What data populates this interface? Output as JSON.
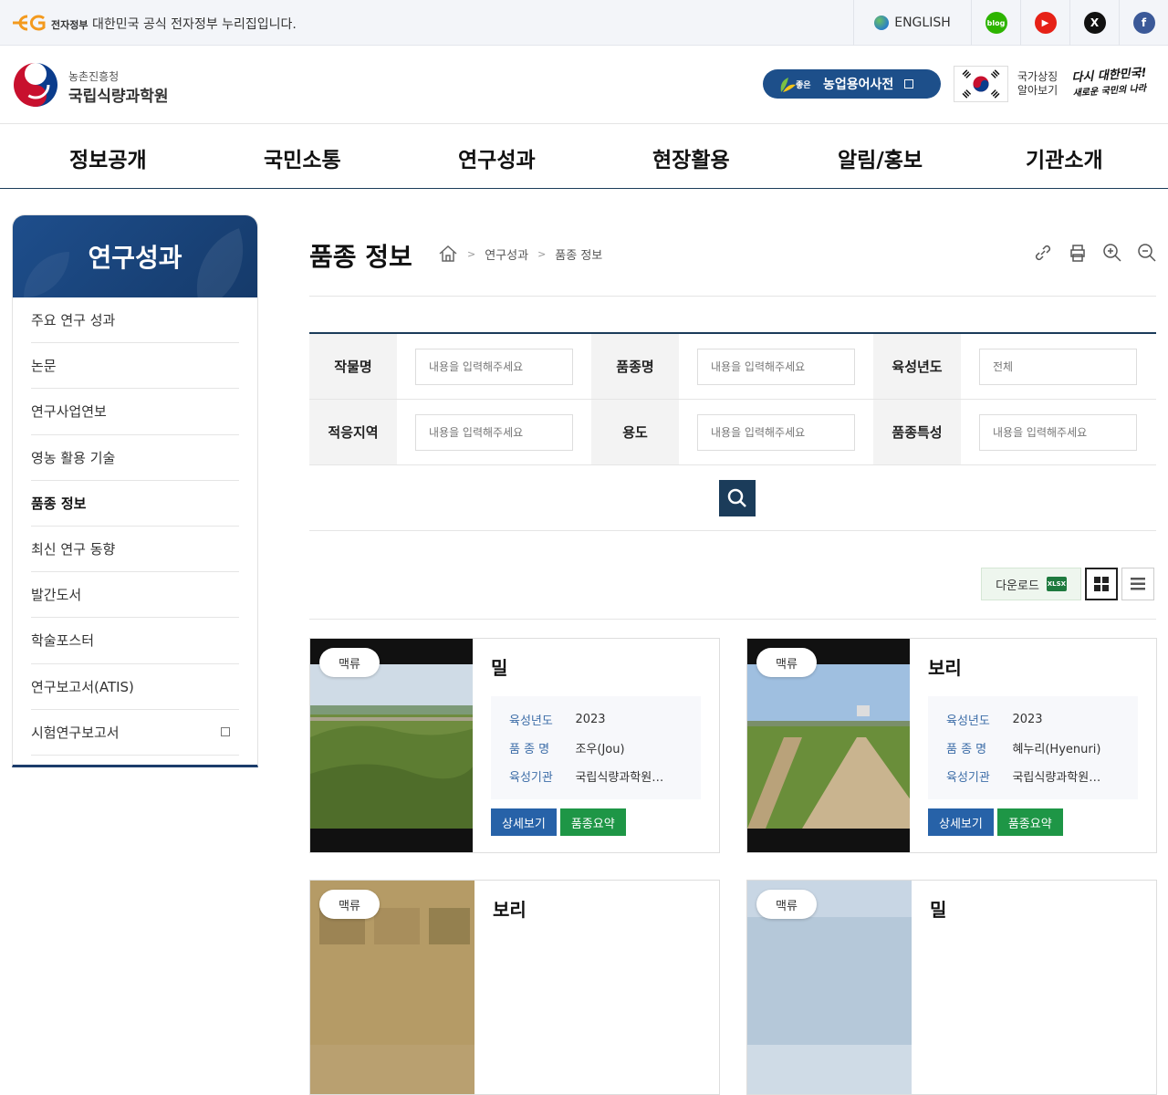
{
  "govbar": {
    "eg_logo": "eG",
    "small_label": "전자정부",
    "notice": "대한민국 공식 전자정부 누리집입니다.",
    "lang_label": "ENGLISH",
    "sns": [
      {
        "name": "blog-icon",
        "glyph": "blog",
        "color": "#2db400"
      },
      {
        "name": "youtube-icon",
        "glyph": "▶",
        "color": "#e62117"
      },
      {
        "name": "x-icon",
        "glyph": "𝕏",
        "color": "#111111"
      },
      {
        "name": "facebook-icon",
        "glyph": "f",
        "color": "#3b5998"
      }
    ]
  },
  "header": {
    "org_small": "농촌진흥청",
    "org_name": "국립식량과학원",
    "dict_button": "농업용어사전",
    "dict_prefix": "좋은",
    "symbol_label_1": "국가상징",
    "symbol_label_2": "알아보기",
    "slogan_1": "다시 대한민국!",
    "slogan_2": "새로운 국민의 나라"
  },
  "gnb": [
    "정보공개",
    "국민소통",
    "연구성과",
    "현장활용",
    "알림/홍보",
    "기관소개"
  ],
  "side": {
    "title": "연구성과",
    "items": [
      {
        "label": "주요 연구 성과",
        "active": false,
        "external": false
      },
      {
        "label": "논문",
        "active": false,
        "external": false
      },
      {
        "label": "연구사업연보",
        "active": false,
        "external": false
      },
      {
        "label": "영농 활용 기술",
        "active": false,
        "external": false
      },
      {
        "label": "품종 정보",
        "active": true,
        "external": false
      },
      {
        "label": "최신 연구 동향",
        "active": false,
        "external": false
      },
      {
        "label": "발간도서",
        "active": false,
        "external": false
      },
      {
        "label": "학술포스터",
        "active": false,
        "external": false
      },
      {
        "label": "연구보고서(ATIS)",
        "active": false,
        "external": false
      },
      {
        "label": "시험연구보고서",
        "active": false,
        "external": true
      }
    ]
  },
  "content": {
    "page_title": "품종 정보",
    "breadcrumb": [
      "연구성과",
      "품종 정보"
    ]
  },
  "search": {
    "row1": [
      {
        "label": "작물명",
        "placeholder": "내용을 입력해주세요"
      },
      {
        "label": "품종명",
        "placeholder": "내용을 입력해주세요"
      },
      {
        "label": "육성년도",
        "placeholder": "전체"
      }
    ],
    "row2": [
      {
        "label": "적응지역",
        "placeholder": "내용을 입력해주세요"
      },
      {
        "label": "용도",
        "placeholder": "내용을 입력해주세요"
      },
      {
        "label": "품종특성",
        "placeholder": "내용을 입력해주세요"
      }
    ]
  },
  "list_tools": {
    "download_label": "다운로드",
    "xls_label": "XLSX"
  },
  "cards": [
    {
      "badge": "맥류",
      "name": "밀",
      "year_label": "육성년도",
      "year": "2023",
      "variety_label": "품 종 명",
      "variety": "조우(Jou)",
      "org_label": "육성기관",
      "org": "국립식량과학원…",
      "detail_btn": "상세보기",
      "summary_btn": "품종요약"
    },
    {
      "badge": "맥류",
      "name": "보리",
      "year_label": "육성년도",
      "year": "2023",
      "variety_label": "품 종 명",
      "variety": "혜누리(Hyenuri)",
      "org_label": "육성기관",
      "org": "국립식량과학원…",
      "detail_btn": "상세보기",
      "summary_btn": "품종요약"
    },
    {
      "badge": "맥류",
      "name": "보리"
    },
    {
      "badge": "맥류",
      "name": "밀"
    }
  ]
}
